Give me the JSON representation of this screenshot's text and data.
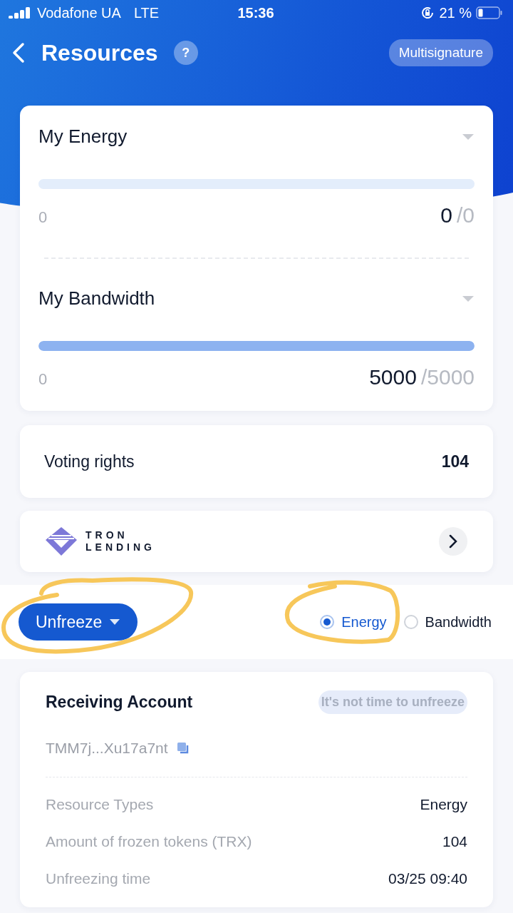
{
  "status_bar": {
    "carrier": "Vodafone UA",
    "network": "LTE",
    "time": "15:36",
    "battery": "21 %"
  },
  "header": {
    "title": "Resources",
    "help": "?",
    "action": "Multisignature"
  },
  "resources": [
    {
      "title": "My Energy",
      "level": 0,
      "min": "0",
      "used": "0",
      "total": "/0"
    },
    {
      "title": "My Bandwidth",
      "level": 1,
      "min": "0",
      "used": "5000",
      "total": "/5000"
    }
  ],
  "voting": {
    "label": "Voting rights",
    "value": "104"
  },
  "banner": {
    "logo_line_1": "TRON",
    "logo_line_2": "LENDING"
  },
  "action_row": {
    "button": "Unfreeze",
    "options": [
      {
        "label": "Energy",
        "selected": true
      },
      {
        "label": "Bandwidth",
        "selected": false
      }
    ]
  },
  "record": {
    "title": "Receiving Account",
    "badge": "It's not time to unfreeze",
    "address": "TMM7j...Xu17a7nt",
    "rows": [
      {
        "label": "Resource Types",
        "value": "Energy"
      },
      {
        "label": "Amount of frozen tokens (TRX)",
        "value": "104"
      },
      {
        "label": "Unfreezing time",
        "value": "03/25 09:40"
      }
    ]
  }
}
